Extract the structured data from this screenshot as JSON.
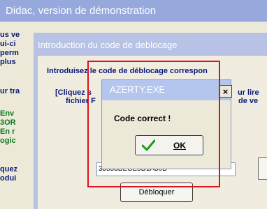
{
  "back_window": {
    "title": "Didac, version de démonstration",
    "lines": [
      "us ve",
      "ui-ci",
      "perm",
      "plus",
      "ur tra",
      "Env",
      "3OR",
      "En r",
      "ogic",
      "quez",
      "odui"
    ]
  },
  "dialog": {
    "title": "Introduction du code de deblocage",
    "instruction": "Introduisez le code de déblocage correspon",
    "note_line1_start": "[Cliquez s",
    "note_line1_end": "ur lire",
    "note_line2_start": "fichier F",
    "note_line2_end": "de ve",
    "code_value": "33553BECE5D1A50B",
    "unlock_label": "Débloquer"
  },
  "message_box": {
    "title": "AZERTY.EXE",
    "close_label": "×",
    "message": "Code correct !",
    "ok_label": "OK",
    "ok_icon": "checkmark-icon"
  },
  "colors": {
    "highlight": "#e0121b",
    "title_text": "#ffffff",
    "dark_blue_text": "#0b1a7a",
    "green_text": "#0a7a1a",
    "check_green": "#1a9a1a"
  }
}
